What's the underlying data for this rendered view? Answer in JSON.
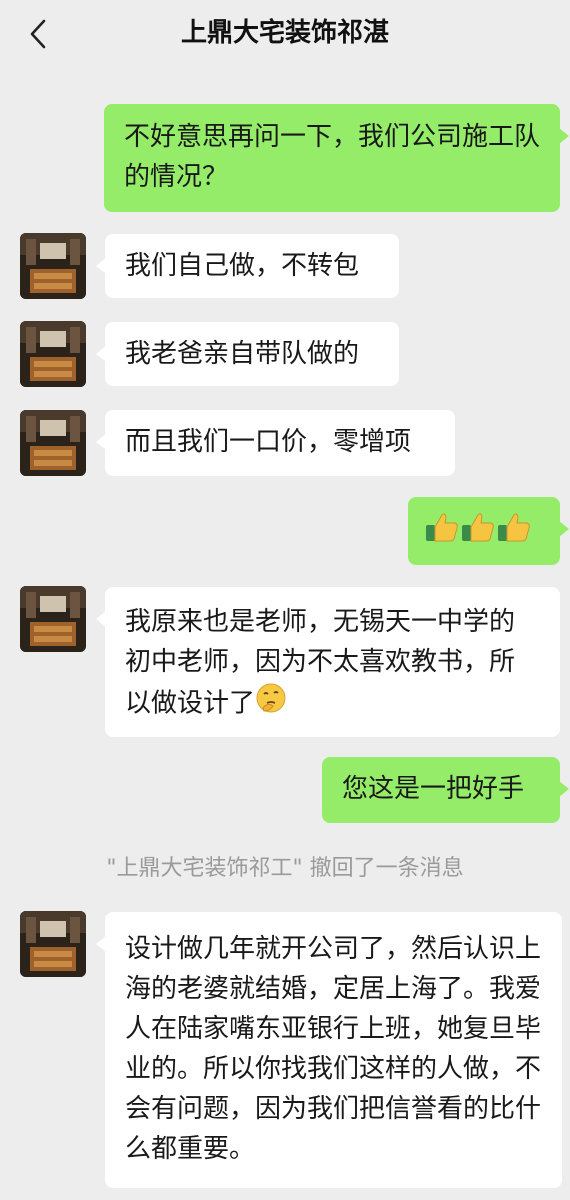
{
  "header": {
    "title": "上鼎大宅装饰祁湛"
  },
  "messages": {
    "m1": "不好意思再问一下，我们公司施工队的情况？",
    "m2": "我们自己做，不转包",
    "m3": "我老爸亲自带队做的",
    "m4": "而且我们一口价，零增项",
    "m5_icons": [
      "thumbs-up",
      "thumbs-up",
      "thumbs-up"
    ],
    "m6": "我原来也是老师，无锡天一中学的初中老师，因为不太喜欢教书，所以做设计了",
    "m6_icon": "thinking-face",
    "m7": "您这是一把好手",
    "m8": "设计做几年就开公司了，然后认识上海的老婆就结婚，定居上海了。我爱人在陆家嘴东亚银行上班，她复旦毕业的。所以你找我们这样的人做，不会有问题，因为我们把信誉看的比什么都重要。"
  },
  "system": {
    "recall": "\"上鼎大宅装饰祁工\" 撤回了一条消息"
  },
  "colors": {
    "background": "#ededed",
    "incoming": "#ffffff",
    "outgoing": "#95ec69",
    "system_text": "#9a9a9a"
  }
}
